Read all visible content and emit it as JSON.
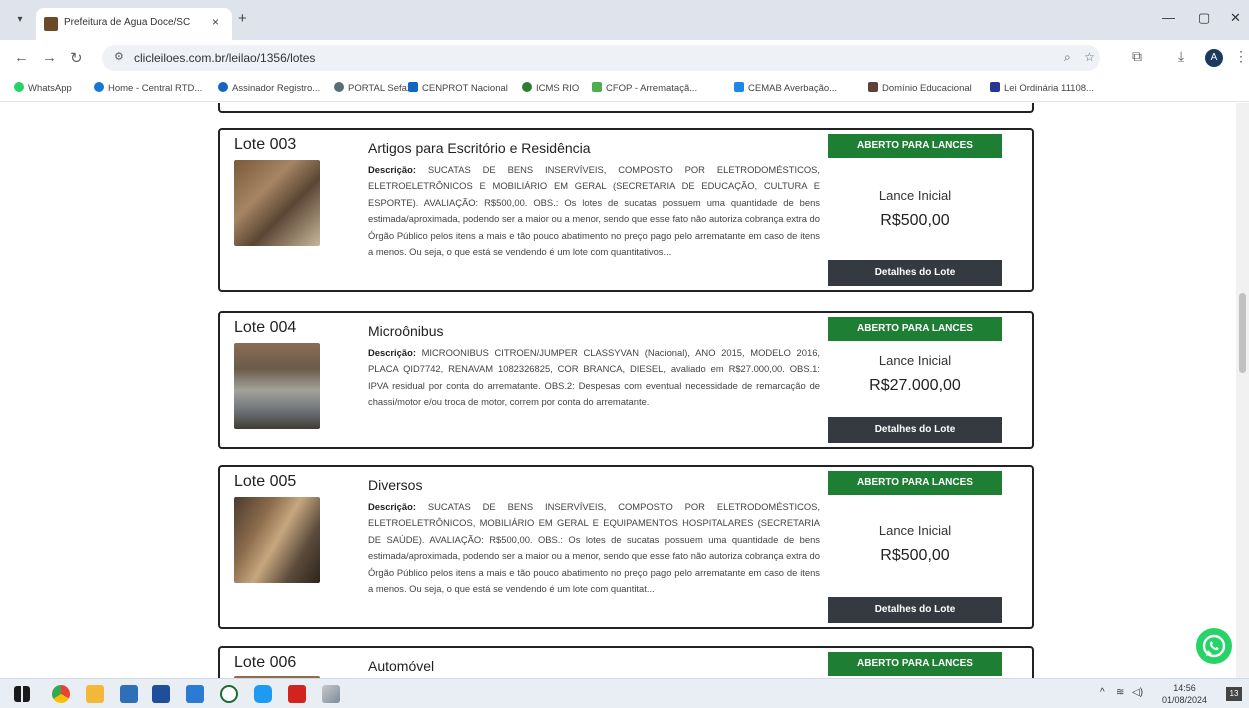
{
  "browser": {
    "tab_title": "Prefeitura de Água Doce/SC",
    "tab_close": "×",
    "new_tab": "+",
    "url": "clicleiloes.com.br/leilao/1356/lotes",
    "profile_initial": "A",
    "bookmarks": [
      {
        "label": "WhatsApp",
        "color": "#25d366"
      },
      {
        "label": "Home - Central RTD...",
        "color": "#1976d2"
      },
      {
        "label": "Assinador Registro...",
        "color": "#1565c0"
      },
      {
        "label": "PORTAL Sefaz",
        "color": "#546e7a"
      },
      {
        "label": "CENPROT Nacional",
        "color": "#1565c0"
      },
      {
        "label": "ICMS RIO",
        "color": "#2e7d32"
      },
      {
        "label": "CFOP - Arremataçã...",
        "color": "#4caf50"
      },
      {
        "label": "CEMAB Averbação...",
        "color": "#1e88e5"
      },
      {
        "label": "Domínio Educacional",
        "color": "#5d4037"
      },
      {
        "label": "Lei Ordinária 11108...",
        "color": "#283593"
      }
    ]
  },
  "lots": [
    {
      "number": "Lote 003",
      "title": "Artigos para Escritório e Residência",
      "desc_label": "Descrição:",
      "description": "SUCATAS DE BENS INSERVÍVEIS, COMPOSTO POR ELETRODOMÉSTICOS, ELETROELETRÔNICOS E MOBILIÁRIO EM GERAL (SECRETARIA DE EDUCAÇÃO, CULTURA E ESPORTE). AVALIAÇÃO: R$500,00. OBS.: Os lotes de sucatas possuem uma quantidade de bens estimada/aproximada, podendo ser a maior ou a menor, sendo que esse fato não autoriza cobrança extra do Órgão Público pelos itens a mais e tão pouco abatimento no preço pago pelo arrematante em caso de itens a menos. Ou seja, o que está se vendendo é um lote com quantitativos...",
      "status": "ABERTO PARA LANCES",
      "lance_label": "Lance Inicial",
      "lance_value": "R$500,00",
      "details_label": "Detalhes do Lote"
    },
    {
      "number": "Lote 004",
      "title": "Microônibus",
      "desc_label": "Descrição:",
      "description": "MICROONIBUS CITROEN/JUMPER CLASSYVAN (Nacional), ANO 2015, MODELO 2016, PLACA QID7742, RENAVAM 1082326825, COR BRANCA, DIESEL, avaliado em R$27.000,00. OBS.1: IPVA residual por conta do arrematante. OBS.2: Despesas com eventual necessidade de remarcação de chassi/motor e/ou troca de motor, correm por conta do arrematante.",
      "status": "ABERTO PARA LANCES",
      "lance_label": "Lance Inicial",
      "lance_value": "R$27.000,00",
      "details_label": "Detalhes do Lote"
    },
    {
      "number": "Lote 005",
      "title": "Diversos",
      "desc_label": "Descrição:",
      "description": "SUCATAS DE BENS INSERVÍVEIS, COMPOSTO POR ELETRODOMÉSTICOS, ELETROELETRÔNICOS, MOBILIÁRIO EM GERAL E EQUIPAMENTOS HOSPITALARES (SECRETARIA DE SAÚDE). AVALIAÇÃO: R$500,00. OBS.: Os lotes de sucatas possuem uma quantidade de bens estimada/aproximada, podendo ser a maior ou a menor, sendo que esse fato não autoriza cobrança extra do Órgão Público pelos itens a mais e tão pouco abatimento no preço pago pelo arrematante em caso de itens a menos. Ou seja, o que está se vendendo é um lote com quantitat...",
      "status": "ABERTO PARA LANCES",
      "lance_label": "Lance Inicial",
      "lance_value": "R$500,00",
      "details_label": "Detalhes do Lote"
    },
    {
      "number": "Lote 006",
      "title": "Automóvel",
      "status": "ABERTO PARA LANCES"
    }
  ],
  "taskbar": {
    "time": "14:56",
    "date": "01/08/2024",
    "notification_count": "13"
  }
}
